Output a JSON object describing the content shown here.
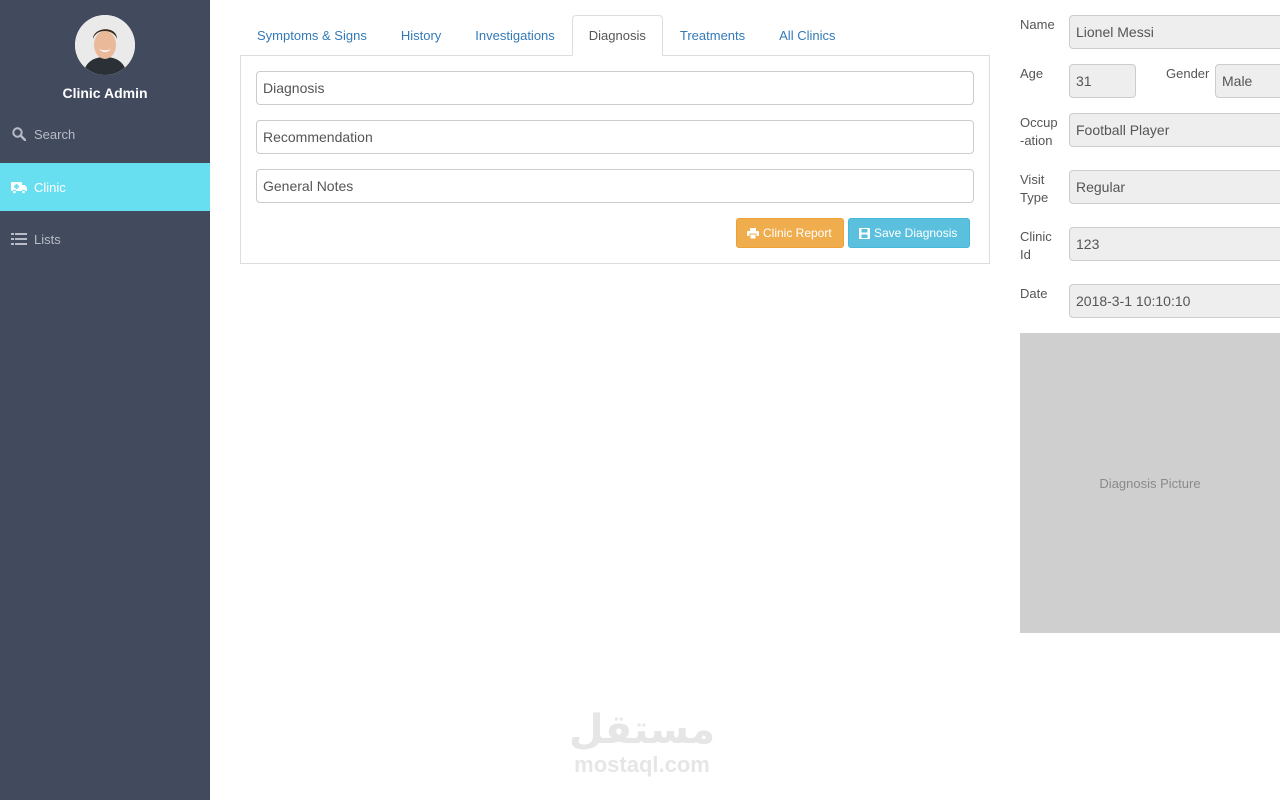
{
  "sidebar": {
    "admin_name": "Clinic Admin",
    "items": [
      {
        "label": "Search",
        "icon": "search-icon"
      },
      {
        "label": "Clinic",
        "icon": "ambulance-icon"
      },
      {
        "label": "Lists",
        "icon": "list-icon"
      }
    ],
    "active_color": "#68dff0",
    "bg_color": "#424a5d"
  },
  "tabs": [
    {
      "label": "Symptoms & Signs"
    },
    {
      "label": "History"
    },
    {
      "label": "Investigations"
    },
    {
      "label": "Diagnosis",
      "active": true
    },
    {
      "label": "Treatments"
    },
    {
      "label": "All Clinics"
    }
  ],
  "diagnosis_form": {
    "diagnosis_placeholder": "Diagnosis",
    "recommendation_placeholder": "Recommendation",
    "notes_placeholder": "General Notes",
    "report_button": "Clinic Report",
    "save_button": "Save Diagnosis"
  },
  "patient": {
    "name_label": "Name",
    "name": "Lionel Messi",
    "age_label": "Age",
    "age": "31",
    "gender_label": "Gender",
    "gender": "Male",
    "occupation_label_1": "Occup",
    "occupation_label_2": "-ation",
    "occupation": "Football Player",
    "visit_type_label_1": "Visit",
    "visit_type_label_2": "Type",
    "visit_type": "Regular",
    "clinic_id_label_1": "Clinic",
    "clinic_id_label_2": "Id",
    "clinic_id": "123",
    "date_label": "Date",
    "date": "2018-3-1 10:10:10",
    "picture_label": "Diagnosis Picture"
  },
  "watermark": {
    "arabic": "مستقل",
    "latin": "mostaql.com"
  }
}
